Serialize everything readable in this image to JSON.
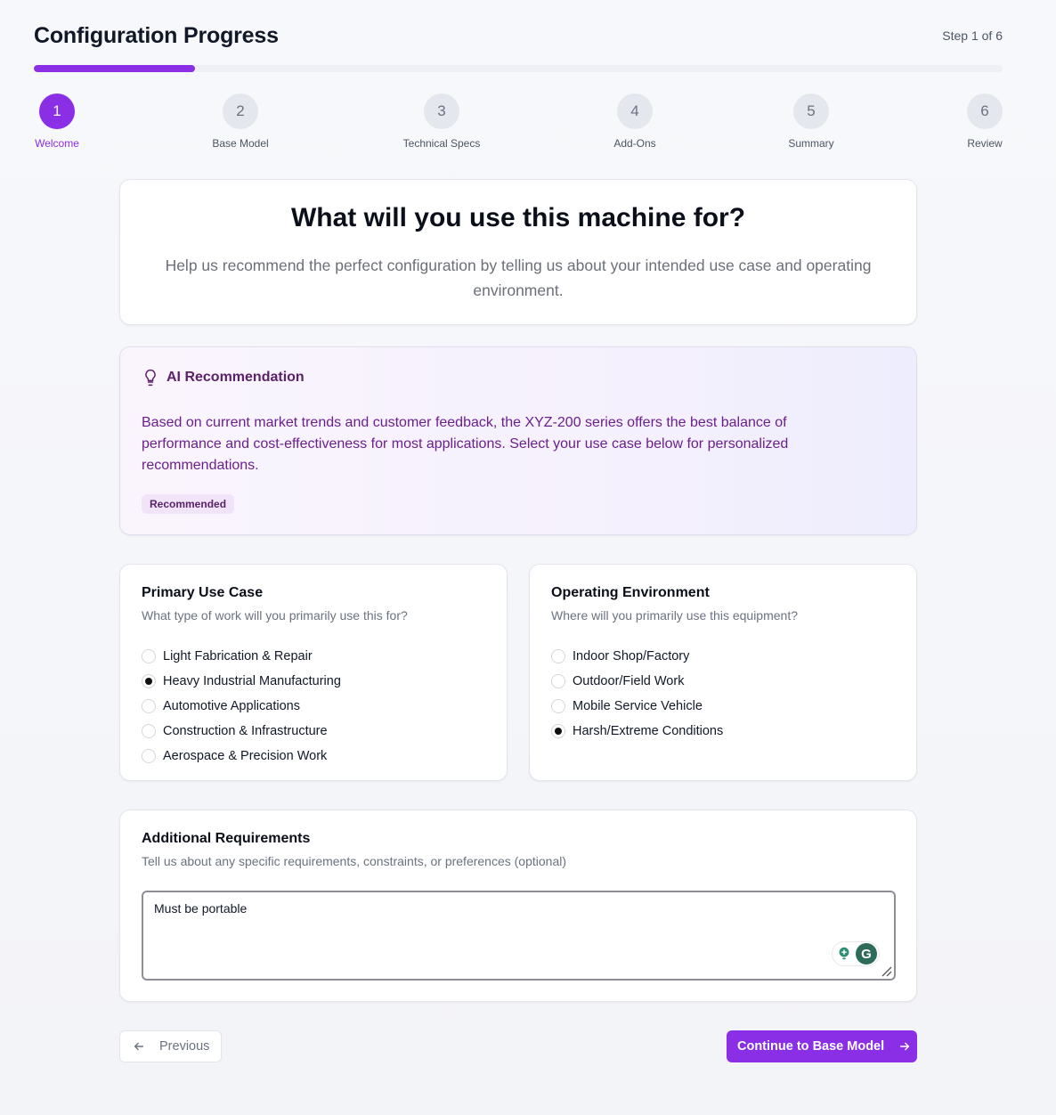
{
  "header": {
    "title": "Configuration Progress",
    "step_count": "Step 1 of 6",
    "progress_fraction": 0.1667
  },
  "steps": [
    {
      "num": "1",
      "label": "Welcome",
      "active": true
    },
    {
      "num": "2",
      "label": "Base Model"
    },
    {
      "num": "3",
      "label": "Technical Specs"
    },
    {
      "num": "4",
      "label": "Add-Ons"
    },
    {
      "num": "5",
      "label": "Summary"
    },
    {
      "num": "6",
      "label": "Review"
    }
  ],
  "intro": {
    "title": "What will you use this machine for?",
    "subtitle": "Help us recommend the perfect configuration by telling us about your intended use case and operating environment."
  },
  "ai": {
    "title": "AI Recommendation",
    "text": "Based on current market trends and customer feedback, the XYZ-200 series offers the best balance of performance and cost-effectiveness for most applications. Select your use case below for personalized recommendations.",
    "badge": "Recommended"
  },
  "use_case": {
    "title": "Primary Use Case",
    "subtitle": "What type of work will you primarily use this for?",
    "options": [
      "Light Fabrication & Repair",
      "Heavy Industrial Manufacturing",
      "Automotive Applications",
      "Construction & Infrastructure",
      "Aerospace & Precision Work"
    ],
    "selected": "Heavy Industrial Manufacturing"
  },
  "environment": {
    "title": "Operating Environment",
    "subtitle": "Where will you primarily use this equipment?",
    "options": [
      "Indoor Shop/Factory",
      "Outdoor/Field Work",
      "Mobile Service Vehicle",
      "Harsh/Extreme Conditions"
    ],
    "selected": "Harsh/Extreme Conditions"
  },
  "additional": {
    "title": "Additional Requirements",
    "subtitle": "Tell us about any specific requirements, constraints, or preferences (optional)",
    "value": "Must be portable"
  },
  "nav": {
    "previous": "Previous",
    "next": "Continue to Base Model"
  },
  "colors": {
    "accent": "#8b2fe6",
    "ai_text": "#6b1f8f"
  }
}
